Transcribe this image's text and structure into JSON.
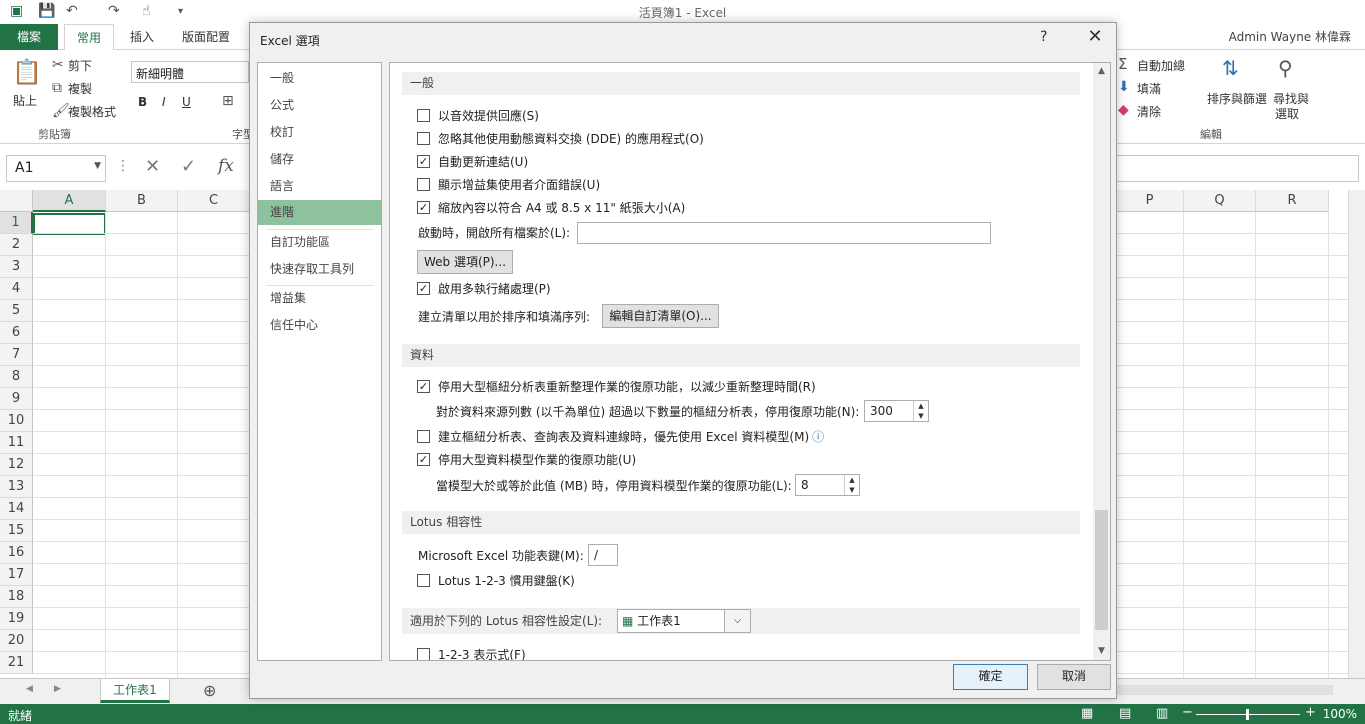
{
  "app": {
    "title": "活頁簿1 - Excel",
    "user": "Admin Wayne 林偉霖",
    "tabs": [
      "檔案",
      "常用",
      "插入",
      "版面配置"
    ]
  },
  "ribbon": {
    "paste": "貼上",
    "cut": "剪下",
    "copy": "複製",
    "format_painter": "複製格式",
    "clipboard_group": "剪貼簿",
    "font_name": "新細明體",
    "bold": "B",
    "italic": "I",
    "underline": "U",
    "font_group_partial": "字型",
    "autosum": "自動加總",
    "fill": "填滿",
    "clear": "清除",
    "sort_filter": "排序與篩選",
    "find_select": "尋找與選取",
    "find_select_line1": "尋找與",
    "find_select_line2": "選取",
    "editing_group": "編輯"
  },
  "formula_bar": {
    "name_box": "A1",
    "fx": "fx"
  },
  "grid": {
    "columns_left": [
      "A",
      "B",
      "C"
    ],
    "columns_right": [
      "P",
      "Q",
      "R"
    ],
    "rows": [
      "1",
      "2",
      "3",
      "4",
      "5",
      "6",
      "7",
      "8",
      "9",
      "10",
      "11",
      "12",
      "13",
      "14",
      "15",
      "16",
      "17",
      "18",
      "19",
      "20",
      "21"
    ]
  },
  "sheet": {
    "tab_name": "工作表1",
    "status": "就緒",
    "zoom": "100%"
  },
  "dialog": {
    "title": "Excel 選項",
    "help": "?",
    "close": "✕",
    "nav": [
      "一般",
      "公式",
      "校訂",
      "儲存",
      "語言",
      "進階",
      "自訂功能區",
      "快速存取工具列",
      "增益集",
      "信任中心"
    ],
    "selected_nav": "進階",
    "sections": {
      "general": "一般",
      "data": "資料",
      "lotus": "Lotus 相容性",
      "lotus_settings": "適用於下列的 Lotus 相容性設定(L):"
    },
    "options": {
      "sound_feedback": "以音效提供回應(S)",
      "ignore_dde": "忽略其他使用動態資料交換 (DDE) 的應用程式(O)",
      "auto_update_links": "自動更新連結(U)",
      "show_addin_errors": "顯示增益集使用者介面錯誤(U)",
      "scale_content": "縮放內容以符合 A4 或 8.5 x 11\" 紙張大小(A)",
      "open_files_label": "啟動時，開啟所有檔案於(L):",
      "web_options": "Web 選項(P)...",
      "multithread": "啟用多執行緒處理(P)",
      "custom_list_label": "建立清單以用於排序和填滿序列:",
      "edit_custom_lists": "編輯自訂清單(O)...",
      "disable_undo_pivot": "停用大型樞紐分析表重新整理作業的復原功能，以減少重新整理時間(R)",
      "pivot_rows_label": "對於資料來源列數 (以千為單位) 超過以下數量的樞紐分析表，停用復原功能(N):",
      "pivot_rows_value": "300",
      "prefer_data_model": "建立樞紐分析表、查詢表及資料連線時，優先使用 Excel 資料模型(M)",
      "info_icon": "ⓘ",
      "disable_undo_model": "停用大型資料模型作業的復原功能(U)",
      "model_size_label": "當模型大於或等於此值 (MB) 時，停用資料模型作業的復原功能(L):",
      "model_size_value": "8",
      "menu_key_label": "Microsoft Excel 功能表鍵(M):",
      "menu_key_value": "/",
      "lotus_nav_keys": "Lotus 1-2-3 慣用鍵盤(K)",
      "lotus_sheet": "工作表1",
      "lotus_expr": "1-2-3 表示式(F)"
    },
    "checked": {
      "sound_feedback": false,
      "ignore_dde": false,
      "auto_update_links": true,
      "show_addin_errors": false,
      "scale_content": true,
      "multithread": true,
      "disable_undo_pivot": true,
      "prefer_data_model": false,
      "disable_undo_model": true,
      "lotus_nav_keys": false,
      "lotus_expr": false
    },
    "buttons": {
      "ok": "確定",
      "cancel": "取消"
    }
  },
  "colors": {
    "excel_green": "#217346",
    "nav_selected": "#8ec19d"
  }
}
